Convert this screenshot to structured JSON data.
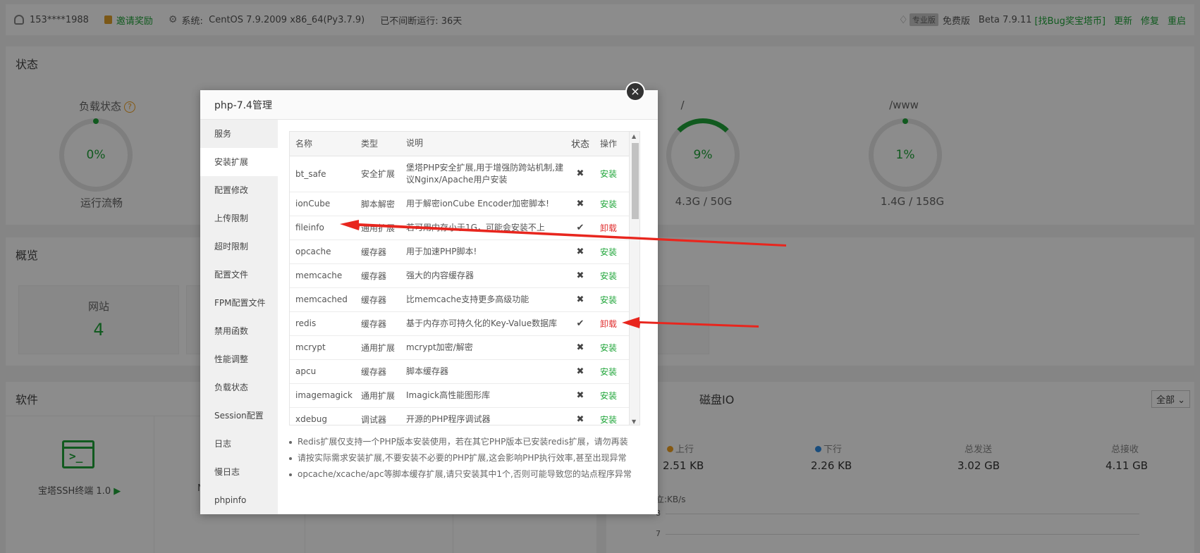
{
  "topbar": {
    "user": "153****1988",
    "invite": "邀请奖励",
    "system_label": "系统:",
    "system_value": "CentOS 7.9.2009 x86_64(Py3.7.9)",
    "uptime": "已不间断运行: 36天",
    "pro_badge": "专业版",
    "edition": "免费版",
    "version": "Beta 7.9.11",
    "bug_link": "[找Bug奖宝塔币]",
    "update": "更新",
    "repair": "修复",
    "restart": "重启"
  },
  "status": {
    "title": "状态",
    "load_label": "负载状态",
    "load_value": "0%",
    "load_desc": "运行流畅",
    "disk1_label": "/",
    "disk1_value": "9%",
    "disk1_desc": "4.3G / 50G",
    "disk2_label": "/www",
    "disk2_value": "1%",
    "disk2_desc": "1.4G / 158G"
  },
  "overview": {
    "title": "概览",
    "site_label": "网站",
    "site_value": "4"
  },
  "software": {
    "title": "软件",
    "ssh_label": "宝塔SSH终端 1.0",
    "partial": "N"
  },
  "diskio": {
    "title": "磁盘IO",
    "select": "全部",
    "up_label": "上行",
    "up_value": "2.51 KB",
    "down_label": "下行",
    "down_value": "2.26 KB",
    "sent_label": "总发送",
    "sent_value": "3.02 GB",
    "recv_label": "总接收",
    "recv_value": "4.11 GB",
    "unit": "立:KB/s",
    "tick1": "8",
    "tick2": "7"
  },
  "modal": {
    "title": "php-7.4管理",
    "close": "×",
    "menu": [
      "服务",
      "安装扩展",
      "配置修改",
      "上传限制",
      "超时限制",
      "配置文件",
      "FPM配置文件",
      "禁用函数",
      "性能调整",
      "负载状态",
      "Session配置",
      "日志",
      "慢日志",
      "phpinfo"
    ],
    "columns": {
      "name": "名称",
      "type": "类型",
      "desc": "说明",
      "state": "状态",
      "op": "操作"
    },
    "rows": [
      {
        "name": "bt_safe",
        "type": "安全扩展",
        "desc": "堡塔PHP安全扩展,用于增强防跨站机制,建议Nginx/Apache用户安装",
        "state": "✖",
        "op": "安装"
      },
      {
        "name": "ionCube",
        "type": "脚本解密",
        "desc": "用于解密ionCube Encoder加密脚本!",
        "state": "✖",
        "op": "安装"
      },
      {
        "name": "fileinfo",
        "type": "通用扩展",
        "desc": "若可用内存小于1G，可能会安装不上",
        "state": "✔",
        "op": "卸载"
      },
      {
        "name": "opcache",
        "type": "缓存器",
        "desc": "用于加速PHP脚本!",
        "state": "✖",
        "op": "安装"
      },
      {
        "name": "memcache",
        "type": "缓存器",
        "desc": "强大的内容缓存器",
        "state": "✖",
        "op": "安装"
      },
      {
        "name": "memcached",
        "type": "缓存器",
        "desc": "比memcache支持更多高级功能",
        "state": "✖",
        "op": "安装"
      },
      {
        "name": "redis",
        "type": "缓存器",
        "desc": "基于内存亦可持久化的Key-Value数据库",
        "state": "✔",
        "op": "卸载"
      },
      {
        "name": "mcrypt",
        "type": "通用扩展",
        "desc": "mcrypt加密/解密",
        "state": "✖",
        "op": "安装"
      },
      {
        "name": "apcu",
        "type": "缓存器",
        "desc": "脚本缓存器",
        "state": "✖",
        "op": "安装"
      },
      {
        "name": "imagemagick",
        "type": "通用扩展",
        "desc": "Imagick高性能图形库",
        "state": "✖",
        "op": "安装"
      },
      {
        "name": "xdebug",
        "type": "调试器",
        "desc": "开源的PHP程序调试器",
        "state": "✖",
        "op": "安装"
      }
    ],
    "tips": [
      "Redis扩展仅支持一个PHP版本安装使用，若在其它PHP版本已安装redis扩展，请勿再装",
      "请按实际需求安装扩展,不要安装不必要的PHP扩展,这会影响PHP执行效率,甚至出现异常",
      "opcache/xcache/apc等脚本缓存扩展,请只安装其中1个,否则可能导致您的站点程序异常"
    ]
  },
  "colors": {
    "accent": "#20a53a",
    "danger": "#e03030",
    "arrow": "#e8261e"
  }
}
